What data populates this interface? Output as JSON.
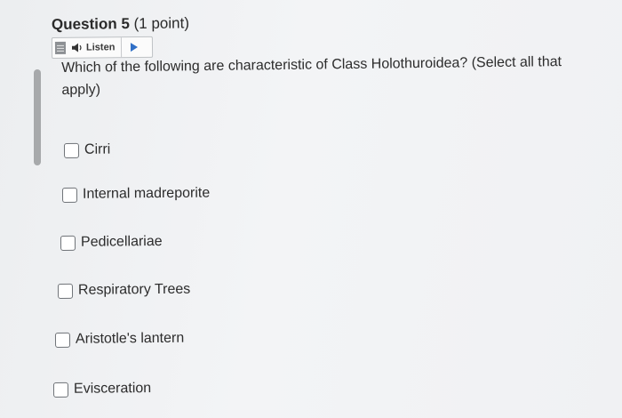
{
  "question": {
    "title": "Question 5",
    "points": "(1 point)",
    "prompt": "Which of the following are characteristic of Class Holothuroidea? (Select all that apply)"
  },
  "listen": {
    "label": "Listen",
    "icons": [
      "menu-icon",
      "speaker-icon",
      "play-icon"
    ],
    "accent_color": "#2f6fc6"
  },
  "options": [
    {
      "label": "Cirri",
      "checked": false
    },
    {
      "label": "Internal madreporite",
      "checked": false
    },
    {
      "label": "Pedicellariae",
      "checked": false
    },
    {
      "label": "Respiratory Trees",
      "checked": false
    },
    {
      "label": "Aristotle's lantern",
      "checked": false
    },
    {
      "label": "Evisceration",
      "checked": false
    }
  ]
}
